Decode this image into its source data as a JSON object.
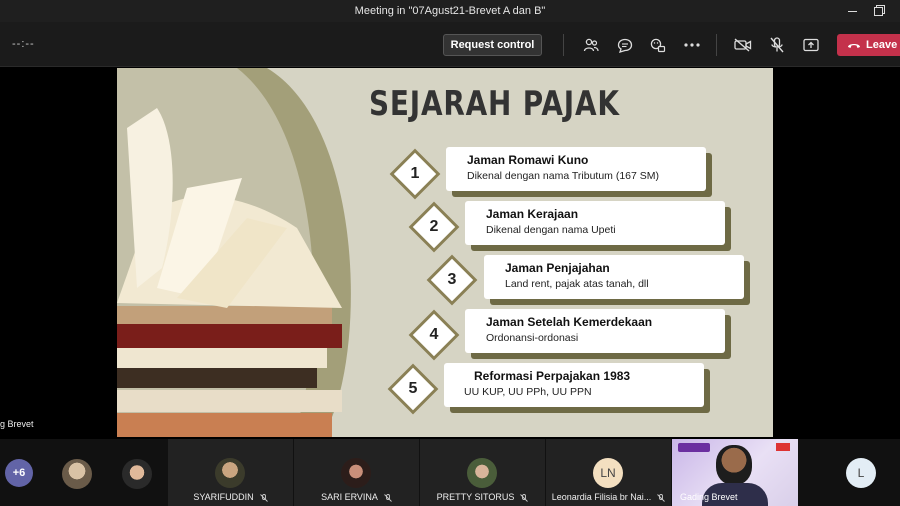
{
  "window": {
    "title": "Meeting in \"07Agust21-Brevet A dan B\""
  },
  "toolbar": {
    "timer": "--:--",
    "request_control_label": "Request control",
    "leave_label": "Leave"
  },
  "slide": {
    "title": "SEJARAH PAJAK",
    "items": [
      {
        "number": "1",
        "heading": "Jaman Romawi Kuno",
        "detail": "Dikenal dengan nama Tributum (167 SM)"
      },
      {
        "number": "2",
        "heading": "Jaman Kerajaan",
        "detail": "Dikenal dengan nama Upeti"
      },
      {
        "number": "3",
        "heading": "Jaman Penjajahan",
        "detail": "Land rent, pajak atas tanah, dll"
      },
      {
        "number": "4",
        "heading": "Jaman Setelah Kemerdekaan",
        "detail": "Ordonansi-ordonasi"
      },
      {
        "number": "5",
        "heading": "Reformasi Perpajakan 1983",
        "detail": "UU KUP, UU PPh, UU PPN"
      }
    ],
    "colors": {
      "background": "#d6d4c4",
      "accent": "#6e6a45",
      "diamond_border": "#8a8055"
    }
  },
  "stage": {
    "presenter_label": "g Brevet"
  },
  "participants": {
    "more_count": "+6",
    "tiles": [
      {
        "name": "SYARIFUDDIN"
      },
      {
        "name": "SARI ERVINA"
      },
      {
        "name": "PRETTY SITORUS"
      },
      {
        "name": "Leonardia Filisia br Nai...",
        "initials": "LN"
      },
      {
        "name": "Gading Brevet"
      },
      {
        "initials": "L"
      }
    ]
  }
}
